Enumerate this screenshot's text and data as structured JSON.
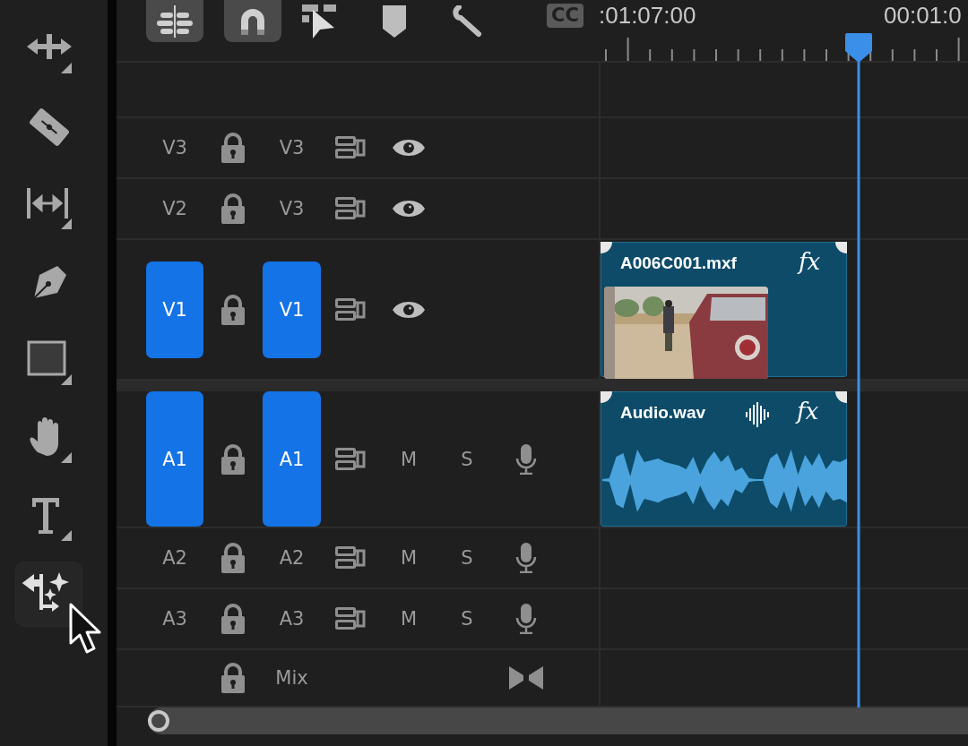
{
  "tools": [
    {
      "kind": "move",
      "selected": false
    },
    {
      "kind": "razor",
      "selected": false
    },
    {
      "kind": "slip",
      "selected": false
    },
    {
      "kind": "pen",
      "selected": false
    },
    {
      "kind": "rectangle",
      "selected": false
    },
    {
      "kind": "hand",
      "selected": false
    },
    {
      "kind": "type",
      "selected": false
    },
    {
      "kind": "generative",
      "selected": true
    }
  ],
  "toolbar": [
    {
      "kind": "nest",
      "on": true
    },
    {
      "kind": "snap",
      "on": true
    },
    {
      "kind": "linked",
      "on": false
    },
    {
      "kind": "marker",
      "on": false
    },
    {
      "kind": "wrench",
      "on": false
    }
  ],
  "cc_badge": "CC",
  "timecodes": [
    ":01:07:00",
    "00:01:0"
  ],
  "tracks": [
    {
      "kind": "video",
      "source": "V3",
      "target": "V3",
      "source_on": false,
      "target_on": false,
      "expanded": false
    },
    {
      "kind": "video",
      "source": "V2",
      "target": "V3",
      "source_on": false,
      "target_on": false,
      "expanded": false
    },
    {
      "kind": "video",
      "source": "V1",
      "target": "V1",
      "source_on": true,
      "target_on": true,
      "expanded": true,
      "clip": {
        "name": "A006C001.mxf",
        "fx": "fx"
      }
    },
    {
      "kind": "audio",
      "source": "A1",
      "target": "A1",
      "source_on": true,
      "target_on": true,
      "expanded": true,
      "mute": "M",
      "solo": "S",
      "clip": {
        "name": "Audio.wav",
        "fx": "fx"
      }
    },
    {
      "kind": "audio",
      "source": "A2",
      "target": "A2",
      "source_on": false,
      "target_on": false,
      "expanded": false,
      "mute": "M",
      "solo": "S"
    },
    {
      "kind": "audio",
      "source": "A3",
      "target": "A3",
      "source_on": false,
      "target_on": false,
      "expanded": false,
      "mute": "M",
      "solo": "S"
    },
    {
      "kind": "mix",
      "target": "Mix"
    }
  ]
}
